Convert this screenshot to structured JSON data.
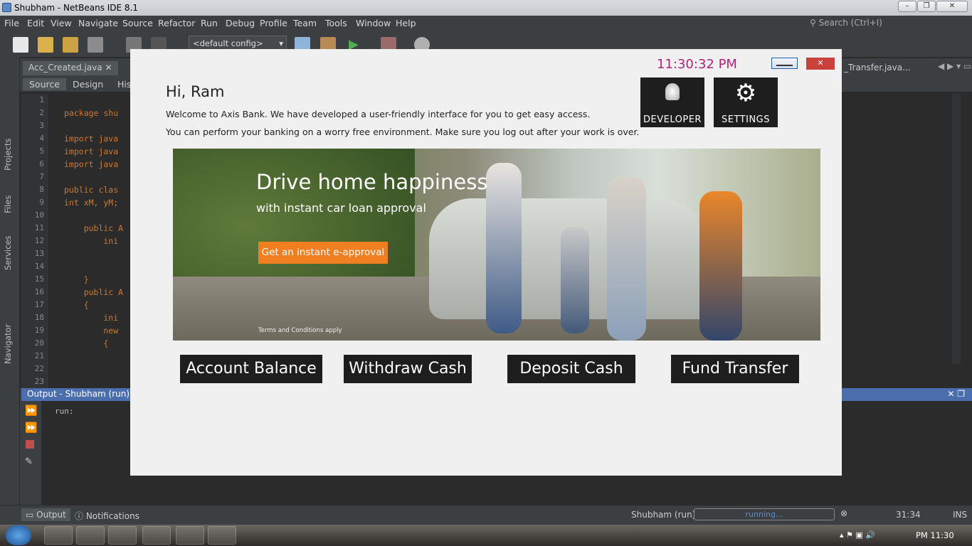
{
  "window": {
    "title": "Shubham - NetBeans IDE 8.1"
  },
  "menu": [
    "File",
    "Edit",
    "View",
    "Navigate",
    "Source",
    "Refactor",
    "Run",
    "Debug",
    "Profile",
    "Team",
    "Tools",
    "Window",
    "Help"
  ],
  "search": {
    "placeholder": "Search (Ctrl+I)"
  },
  "toolbar": {
    "config": "<default config>"
  },
  "editor": {
    "tab_active": "Acc_Created.java",
    "tab_right": "_Transfer.java...",
    "subtabs": [
      "Source",
      "Design",
      "His"
    ],
    "line_numbers": [
      "1",
      "2",
      "3",
      "4",
      "5",
      "6",
      "7",
      "8",
      "9",
      "10",
      "11",
      "12",
      "13",
      "14",
      "15",
      "16",
      "17",
      "18",
      "19",
      "20",
      "21",
      "22",
      "23"
    ],
    "code": [
      "",
      "package shu",
      "",
      "import java",
      "import java",
      "import java",
      "",
      "public clas",
      "int xM, yM;",
      "",
      "    public A",
      "        ini",
      "",
      "",
      "    }",
      "    public A",
      "    {",
      "        ini",
      "        new",
      "        {",
      "",
      "",
      ""
    ]
  },
  "side_labels": [
    "Projects",
    "Files",
    "Services",
    "Navigator"
  ],
  "output": {
    "title": "Output - Shubham (run)",
    "text": "run:"
  },
  "statusbar": {
    "tab_output": "Output",
    "tab_notifications": "Notifications",
    "process": "Shubham (run)",
    "progress_text": "running...",
    "position": "31:34",
    "mode": "INS"
  },
  "taskbar": {
    "clock": "PM 11:30"
  },
  "dialog": {
    "clock": "11:30:32 PM",
    "greeting": "Hi, Ram",
    "welcome_line1": "Welcome to Axis Bank. We have developed a user-friendly interface for you to get easy access.",
    "welcome_line2": "You can perform your banking on a worry free environment. Make sure you log out after your work is over.",
    "tile_developer": "DEVELOPER",
    "tile_settings": "SETTINGS",
    "banner": {
      "headline": "Drive home happiness",
      "subline": "with instant car loan approval",
      "cta": "Get an instant e-approval",
      "terms": "Terms and Conditions apply"
    },
    "buttons": [
      "Account Balance",
      "Withdraw Cash",
      "Deposit Cash",
      "Fund Transfer"
    ],
    "accent": "#b0227a",
    "cta_color": "#f07f22"
  }
}
